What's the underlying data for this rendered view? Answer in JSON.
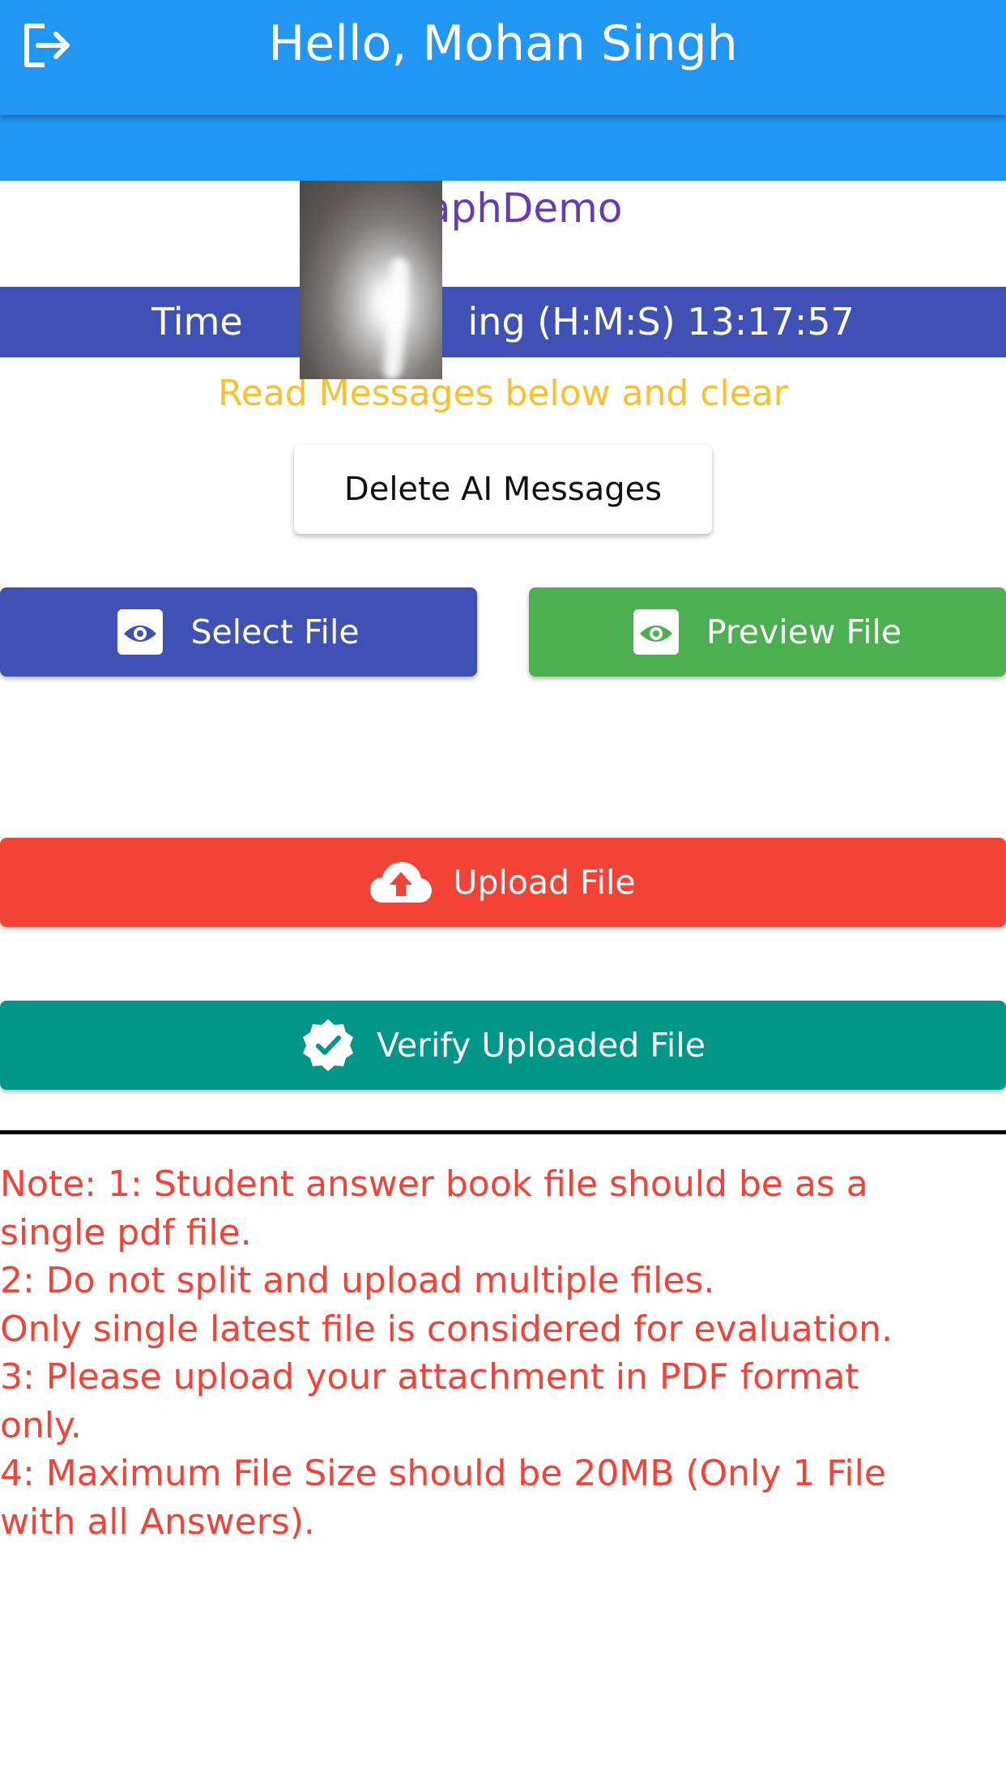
{
  "app_bar": {
    "title": "Hello, Mohan Singh",
    "logout_icon": "logout-icon"
  },
  "course_name": "graphDemo",
  "timer_text": "Time                   ing (H:M:S) 13:17:57",
  "instruction": "Read Messages below and clear",
  "buttons": {
    "delete_ai": "Delete AI Messages",
    "select_file": "Select File",
    "preview_file": "Preview File",
    "upload_file": "Upload File",
    "verify_file": "Verify Uploaded File"
  },
  "icons": {
    "select": "eye-icon",
    "preview": "eye-icon",
    "upload": "cloud-upload-icon",
    "verify": "verified-badge-icon"
  },
  "notes": [
    "Note: 1: Student answer book file should be as a",
    "single pdf file.",
    "2: Do not split and upload multiple files.",
    "Only single latest file is considered for evaluation.",
    "3: Please upload your attachment in PDF format",
    "only.",
    "4: Maximum File Size should be 20MB (Only 1 File",
    "with all Answers)."
  ],
  "colors": {
    "app_bar": "#2196f3",
    "course_name": "#673ab7",
    "timer_bar": "#3f51b5",
    "instruction": "#fbc02d",
    "select_button": "#3f51b5",
    "preview_button": "#4caf50",
    "upload_button": "#f44336",
    "verify_button": "#009688",
    "notes_text": "#f44336"
  }
}
